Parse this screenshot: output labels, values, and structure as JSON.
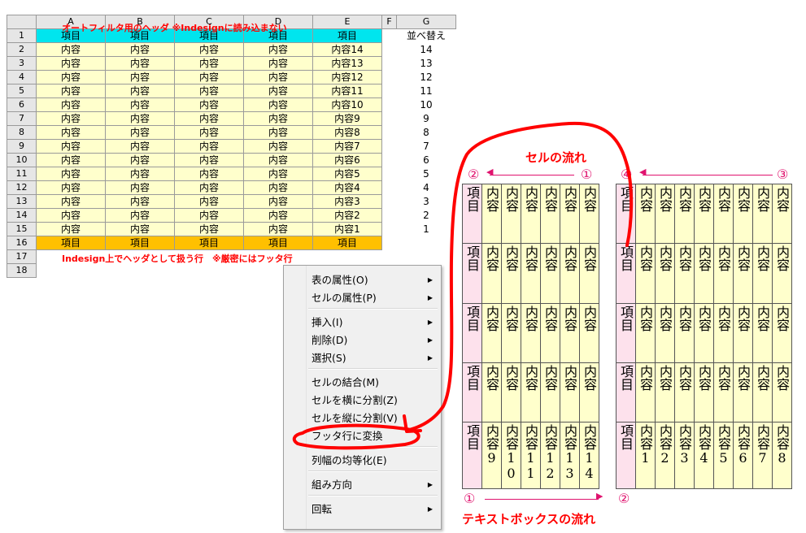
{
  "spreadsheet": {
    "columns": [
      "A",
      "B",
      "C",
      "D",
      "E",
      "F",
      "G"
    ],
    "row_numbers": [
      "1",
      "2",
      "3",
      "4",
      "5",
      "6",
      "7",
      "8",
      "9",
      "10",
      "11",
      "12",
      "13",
      "14",
      "15",
      "16",
      "17",
      "18"
    ],
    "header_row": [
      "項目",
      "項目",
      "項目",
      "項目",
      "項目"
    ],
    "sort_label": "並べ替え",
    "body_rows": [
      {
        "a": "内容",
        "b": "内容",
        "c": "内容",
        "d": "内容",
        "e": "内容14",
        "g": "14"
      },
      {
        "a": "内容",
        "b": "内容",
        "c": "内容",
        "d": "内容",
        "e": "内容13",
        "g": "13"
      },
      {
        "a": "内容",
        "b": "内容",
        "c": "内容",
        "d": "内容",
        "e": "内容12",
        "g": "12"
      },
      {
        "a": "内容",
        "b": "内容",
        "c": "内容",
        "d": "内容",
        "e": "内容11",
        "g": "11"
      },
      {
        "a": "内容",
        "b": "内容",
        "c": "内容",
        "d": "内容",
        "e": "内容10",
        "g": "10"
      },
      {
        "a": "内容",
        "b": "内容",
        "c": "内容",
        "d": "内容",
        "e": "内容9",
        "g": "9"
      },
      {
        "a": "内容",
        "b": "内容",
        "c": "内容",
        "d": "内容",
        "e": "内容8",
        "g": "8"
      },
      {
        "a": "内容",
        "b": "内容",
        "c": "内容",
        "d": "内容",
        "e": "内容7",
        "g": "7"
      },
      {
        "a": "内容",
        "b": "内容",
        "c": "内容",
        "d": "内容",
        "e": "内容6",
        "g": "6"
      },
      {
        "a": "内容",
        "b": "内容",
        "c": "内容",
        "d": "内容",
        "e": "内容5",
        "g": "5"
      },
      {
        "a": "内容",
        "b": "内容",
        "c": "内容",
        "d": "内容",
        "e": "内容4",
        "g": "4"
      },
      {
        "a": "内容",
        "b": "内容",
        "c": "内容",
        "d": "内容",
        "e": "内容3",
        "g": "3"
      },
      {
        "a": "内容",
        "b": "内容",
        "c": "内容",
        "d": "内容",
        "e": "内容2",
        "g": "2"
      },
      {
        "a": "内容",
        "b": "内容",
        "c": "内容",
        "d": "内容",
        "e": "内容1",
        "g": "1"
      }
    ],
    "footer_row": [
      "項目",
      "項目",
      "項目",
      "項目",
      "項目"
    ],
    "note_header": "オートフィルタ用のヘッダ ※Indesignに読み込まない",
    "note_footer": "Indesign上でヘッダとして扱う行　※厳密にはフッタ行"
  },
  "context_menu": {
    "items": [
      {
        "label": "表の属性(O)",
        "submenu": true
      },
      {
        "label": "セルの属性(P)",
        "submenu": true
      },
      {
        "label": "挿入(I)",
        "submenu": true
      },
      {
        "label": "削除(D)",
        "submenu": true
      },
      {
        "label": "選択(S)",
        "submenu": true
      },
      {
        "label": "セルの結合(M)",
        "submenu": false
      },
      {
        "label": "セルを横に分割(Z)",
        "submenu": false
      },
      {
        "label": "セルを縦に分割(V)",
        "submenu": false
      },
      {
        "label": "フッタ行に変換",
        "submenu": false
      },
      {
        "label": "列幅の均等化(E)",
        "submenu": false
      },
      {
        "label": "組み方向",
        "submenu": true
      },
      {
        "label": "回転",
        "submenu": true
      }
    ]
  },
  "vertical_tables": {
    "header_cell": "項目",
    "content_cell": "内容",
    "left_footer_cells": [
      "内容9",
      "内容10",
      "内容11",
      "内容12",
      "内容13",
      "内容14"
    ],
    "right_footer_cells": [
      "内容1",
      "内容2",
      "内容3",
      "内容4",
      "内容5",
      "内容6",
      "内容7",
      "内容8"
    ]
  },
  "annotations": {
    "cell_flow_label": "セルの流れ",
    "textbox_flow_label": "テキストボックスの流れ",
    "marker_1": "①",
    "marker_2": "②",
    "marker_3": "③",
    "marker_4": "④"
  },
  "colors": {
    "header_cyan": "#00e5ee",
    "body_yellow": "#ffffcc",
    "footer_orange": "#ffc000",
    "annotation_red": "#ff0000",
    "arrow_pink": "#e0126e",
    "vertical_header_pink": "#fde1ec"
  }
}
